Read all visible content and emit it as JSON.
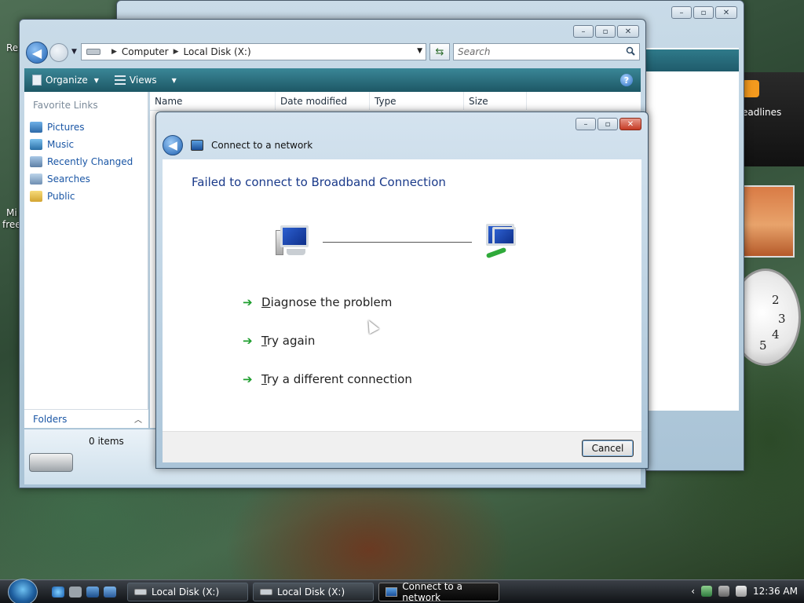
{
  "desktop": {
    "label_re": "Re",
    "label_mi": "Mi",
    "label_free": "free"
  },
  "gadgets": {
    "feed_label": "eadlines",
    "clock_numbers": [
      "2",
      "3",
      "4",
      "5"
    ]
  },
  "explorer": {
    "address": {
      "segments": [
        "Computer",
        "Local Disk (X:)"
      ]
    },
    "search": {
      "placeholder": "Search"
    },
    "toolbar": {
      "organize": "Organize",
      "views": "Views",
      "help": "?"
    },
    "nav": {
      "heading": "Favorite Links",
      "items": [
        "Pictures",
        "Music",
        "Recently Changed",
        "Searches",
        "Public"
      ],
      "folders": "Folders"
    },
    "columns": [
      "Name",
      "Date modified",
      "Type",
      "Size"
    ],
    "details": {
      "items_count": "0 items"
    }
  },
  "dialog": {
    "title": "Connect to a network",
    "heading": "Failed to connect to Broadband Connection",
    "tasks": [
      {
        "first": "D",
        "rest": "iagnose the problem"
      },
      {
        "first": "T",
        "rest": "ry again"
      },
      {
        "first": "T",
        "rest": "ry a different connection"
      }
    ],
    "cancel": "Cancel"
  },
  "taskbar": {
    "buttons": [
      "Local Disk (X:)",
      "Local Disk (X:)",
      "Connect to a network"
    ],
    "time": "12:36 AM"
  },
  "colors": {
    "link_blue": "#1a56a5",
    "heading_blue": "#1a3a8a",
    "toolbar_teal": "#2b6f7f",
    "arrow_green": "#1e9e2e"
  }
}
